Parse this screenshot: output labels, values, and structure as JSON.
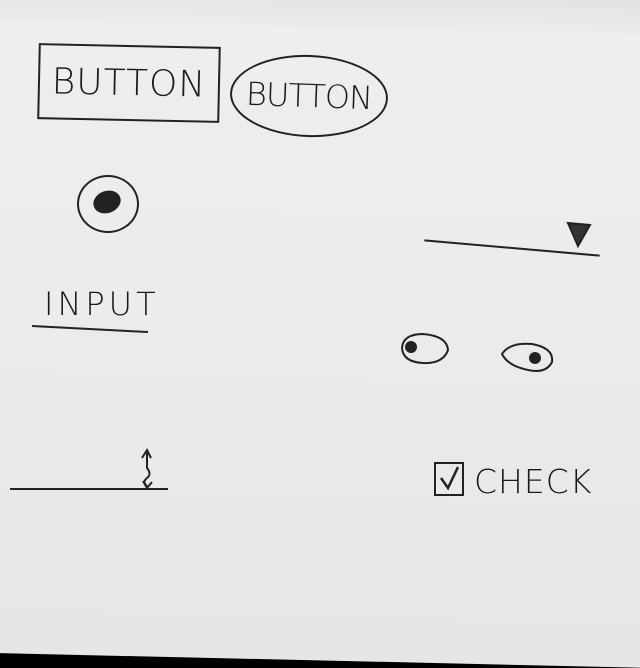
{
  "buttons": {
    "rect_label": "BUTTON",
    "oval_label": "BUTTON"
  },
  "radio": {
    "selected": true
  },
  "input": {
    "label": "INPUT"
  },
  "number_field": {
    "icon": "up-down-arrow-icon"
  },
  "dropdown": {
    "icon": "triangle-down-icon"
  },
  "toggles": {
    "icons": [
      "eye-icon",
      "eye-icon"
    ]
  },
  "checkbox": {
    "label": "CHECK",
    "checked": true
  },
  "colors": {
    "ink": "#1a1a1a",
    "paper": "#ececec",
    "background": "#000000"
  }
}
